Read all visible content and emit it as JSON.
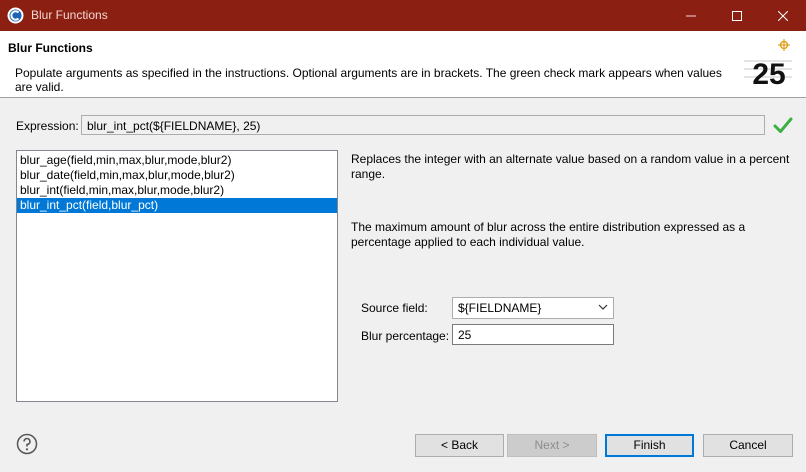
{
  "window": {
    "title": "Blur Functions"
  },
  "banner": {
    "title": "Blur Functions",
    "description": "Populate arguments as specified in the instructions. Optional arguments are in brackets. The green check mark appears when values are valid.",
    "image_number": "25"
  },
  "expression": {
    "label": "Expression:",
    "value": "blur_int_pct(${FIELDNAME}, 25)"
  },
  "functions": [
    {
      "label": "blur_age(field,min,max,blur,mode,blur2)"
    },
    {
      "label": "blur_date(field,min,max,blur,mode,blur2)"
    },
    {
      "label": "blur_int(field,min,max,blur,mode,blur2)"
    },
    {
      "label": "blur_int_pct(field,blur_pct)"
    }
  ],
  "selected_function_index": 3,
  "details": {
    "description": "Replaces the integer with an alternate value based on a random value in a percent range.",
    "argument_help": "The maximum amount of blur across the entire distribution expressed as a percentage applied to each individual value."
  },
  "form": {
    "source_label": "Source field:",
    "source_value": "${FIELDNAME}",
    "blur_label": "Blur percentage:",
    "blur_value": "25"
  },
  "buttons": {
    "back": "< Back",
    "next": "Next >",
    "finish": "Finish",
    "cancel": "Cancel"
  },
  "colors": {
    "titlebar": "#8b2012",
    "selection": "#0078d7",
    "valid_check": "#3cb043"
  }
}
